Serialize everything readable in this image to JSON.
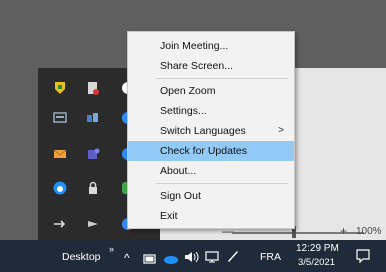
{
  "context_menu": {
    "items": [
      {
        "label": "Join Meeting..."
      },
      {
        "label": "Share Screen..."
      },
      {
        "label": "Open Zoom"
      },
      {
        "label": "Settings..."
      },
      {
        "label": "Switch Languages",
        "submenu_arrow": ">"
      },
      {
        "label": "Check for Updates",
        "highlighted": true
      },
      {
        "label": "About..."
      },
      {
        "label": "Sign Out"
      },
      {
        "label": "Exit"
      }
    ]
  },
  "zoom_bar": {
    "minus": "—",
    "plus": "+",
    "level": "100%"
  },
  "taskbar": {
    "toolbar_label": "Desktop",
    "overflow": "»",
    "chevron": "^",
    "language": "FRA",
    "time": "12:29 PM",
    "date": "3/5/2021"
  },
  "tray_icons": [
    "security-shield-icon",
    "document-icon",
    "zoom-icon",
    "keyboard-icon",
    "network-share-icon",
    "zoom-icon",
    "mail-icon",
    "teams-icon",
    "zoom-icon",
    "cloud-icon",
    "lock-icon",
    "app-icon",
    "usb-icon",
    "flag-icon",
    "zoom-icon"
  ],
  "colors": {
    "desktop_bg": "#5f5f5f",
    "tray_bg": "#2b2b2b",
    "menu_bg": "#f2f2f2",
    "menu_highlight": "#91c9f7",
    "taskbar_bg": "#1f2a3b"
  }
}
